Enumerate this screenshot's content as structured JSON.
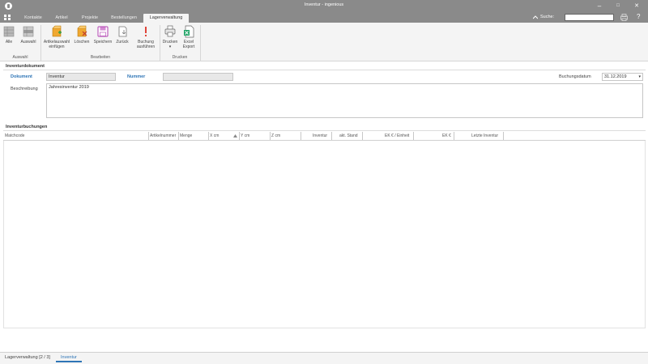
{
  "window": {
    "title": "Inventur - ingenious",
    "minimize": "–",
    "maximize": "□",
    "close": "✕"
  },
  "tabs": [
    "Kontakte",
    "Artikel",
    "Projekte",
    "Bestellungen",
    "Lagerverwaltung"
  ],
  "active_tab": "Lagerverwaltung",
  "search": {
    "label": "Suche:",
    "value": ""
  },
  "ribbon": {
    "groups": [
      {
        "label": "Auswahl",
        "buttons": [
          "Alle",
          "Auswahl"
        ]
      },
      {
        "label": "Bearbeiten",
        "buttons": [
          "Artikelauswahl einfügen",
          "Löschen",
          "Speichern",
          "Zurück",
          "Buchung ausführen"
        ]
      },
      {
        "label": "Drucken",
        "buttons": [
          "Drucken",
          "Excel Export"
        ]
      }
    ],
    "icons": {
      "alle": "table-icon",
      "auswahl": "table-select-icon",
      "artikelauswahl": "box-add-icon",
      "loeschen": "box-delete-icon",
      "speichern": "save-icon",
      "zurueck": "undo-icon",
      "buchung": "exclamation-icon",
      "drucken": "printer-icon",
      "excel": "excel-icon"
    },
    "drucken_arrow": "▾"
  },
  "inventurdokument": {
    "section_title": "Inventurdokument",
    "dokument_label": "Dokument",
    "dokument_value": "Inventur",
    "nummer_label": "Nummer",
    "nummer_value": "",
    "buchungsdatum_label": "Buchungsdatum",
    "buchungsdatum_value": "31.12.2019",
    "beschreibung_label": "Beschreibung",
    "beschreibung_value": "Jahresinventur 2019"
  },
  "inventurbuchungen": {
    "section_title": "Inventurbuchungen",
    "columns": [
      "Matchcode",
      "Artikelnummer",
      "Menge",
      "X cm",
      "Y cm",
      "Z cm",
      "Inventur",
      "akt. Stand",
      "EK € / Einheit",
      "EK €",
      "Letzte Inventur"
    ],
    "rows": []
  },
  "statusbar": {
    "items": [
      "Lagerverwaltung [2 / 3]",
      "Inventur"
    ],
    "active": "Inventur"
  },
  "colors": {
    "chrome": "#8a8a8a",
    "accent": "#2e75b6"
  }
}
